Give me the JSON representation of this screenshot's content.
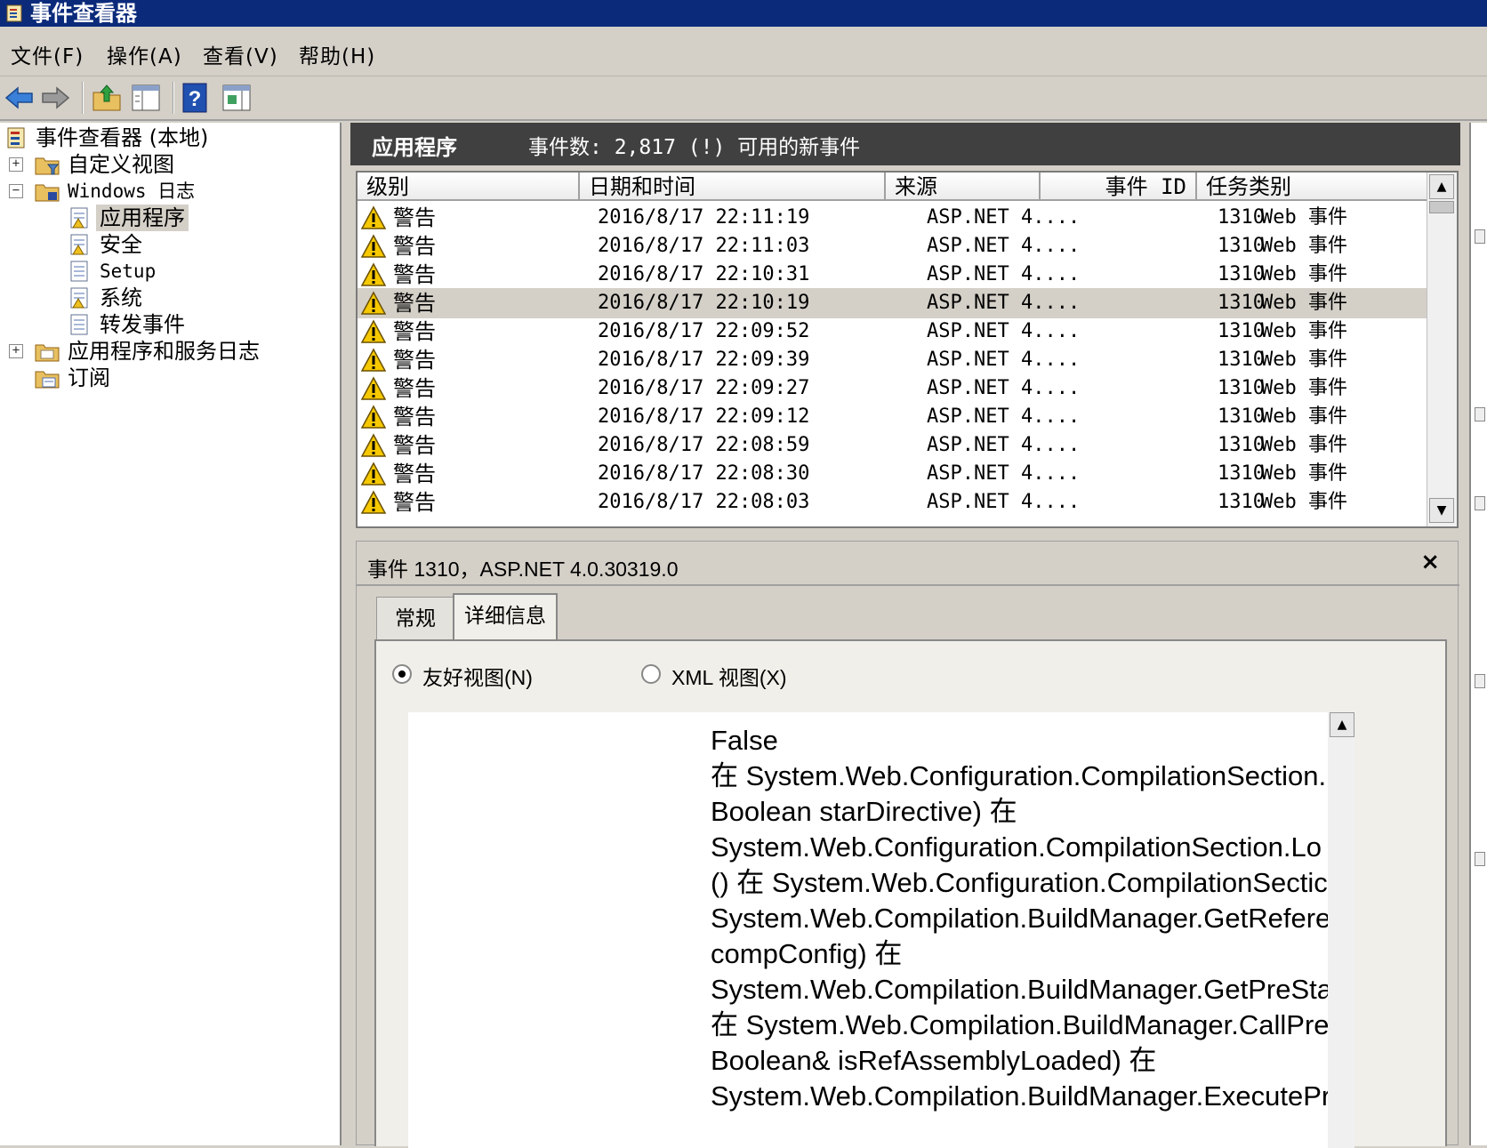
{
  "window": {
    "title": "事件查看器"
  },
  "menu": [
    "文件(F)",
    "操作(A)",
    "查看(V)",
    "帮助(H)"
  ],
  "toolbar": {
    "icons": [
      "back-arrow-icon",
      "forward-arrow-icon",
      "up-folder-icon",
      "show-hide-tree-icon",
      "help-icon",
      "show-action-pane-icon"
    ]
  },
  "tree": {
    "root": "事件查看器 (本地)",
    "custom_views": "自定义视图",
    "windows_logs": "Windows 日志",
    "application": "应用程序",
    "security": "安全",
    "setup": "Setup",
    "system": "系统",
    "forwarded": "转发事件",
    "app_services": "应用程序和服务日志",
    "subscriptions": "订阅"
  },
  "log": {
    "name": "应用程序",
    "count_text": "事件数: 2,817 (!) 可用的新事件",
    "columns": [
      "级别",
      "日期和时间",
      "来源",
      "事件 ID",
      "任务类别"
    ],
    "rows": [
      {
        "level": "警告",
        "date": "2016/8/17 22:11:19",
        "source": "ASP.NET 4....",
        "id": "1310",
        "task": "Web 事件"
      },
      {
        "level": "警告",
        "date": "2016/8/17 22:11:03",
        "source": "ASP.NET 4....",
        "id": "1310",
        "task": "Web 事件"
      },
      {
        "level": "警告",
        "date": "2016/8/17 22:10:31",
        "source": "ASP.NET 4....",
        "id": "1310",
        "task": "Web 事件"
      },
      {
        "level": "警告",
        "date": "2016/8/17 22:10:19",
        "source": "ASP.NET 4....",
        "id": "1310",
        "task": "Web 事件"
      },
      {
        "level": "警告",
        "date": "2016/8/17 22:09:52",
        "source": "ASP.NET 4....",
        "id": "1310",
        "task": "Web 事件"
      },
      {
        "level": "警告",
        "date": "2016/8/17 22:09:39",
        "source": "ASP.NET 4....",
        "id": "1310",
        "task": "Web 事件"
      },
      {
        "level": "警告",
        "date": "2016/8/17 22:09:27",
        "source": "ASP.NET 4....",
        "id": "1310",
        "task": "Web 事件"
      },
      {
        "level": "警告",
        "date": "2016/8/17 22:09:12",
        "source": "ASP.NET 4....",
        "id": "1310",
        "task": "Web 事件"
      },
      {
        "level": "警告",
        "date": "2016/8/17 22:08:59",
        "source": "ASP.NET 4....",
        "id": "1310",
        "task": "Web 事件"
      },
      {
        "level": "警告",
        "date": "2016/8/17 22:08:30",
        "source": "ASP.NET 4....",
        "id": "1310",
        "task": "Web 事件"
      },
      {
        "level": "警告",
        "date": "2016/8/17 22:08:03",
        "source": "ASP.NET 4....",
        "id": "1310",
        "task": "Web 事件"
      }
    ]
  },
  "detail": {
    "title": "事件 1310，ASP.NET 4.0.30319.0",
    "close": "×",
    "tabs": [
      "常规",
      "详细信息"
    ],
    "radio_friendly": "友好视图(N)",
    "radio_xml": "XML 视图(X)",
    "lines": [
      " False",
      "在 System.Web.Configuration.CompilationSection.",
      "Boolean starDirective) 在",
      "System.Web.Configuration.CompilationSection.Lo",
      "() 在 System.Web.Configuration.CompilationSectic",
      "System.Web.Compilation.BuildManager.GetRefere",
      "compConfig) 在",
      "System.Web.Compilation.BuildManager.GetPreSta",
      "在 System.Web.Compilation.BuildManager.CallPre",
      "Boolean& isRefAssemblyLoaded) 在",
      "System.Web.Compilation.BuildManager.ExecutePr"
    ]
  }
}
